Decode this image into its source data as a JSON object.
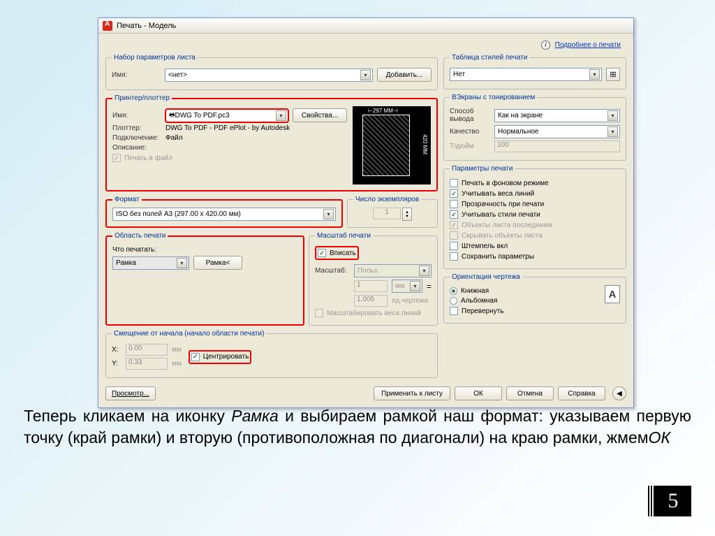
{
  "window": {
    "title": "Печать - Модель"
  },
  "info_link": "Подробнее о печати",
  "page_setup": {
    "legend": "Набор параметров листа",
    "name_label": "Имя:",
    "name_value": "<нет>",
    "add_btn": "Добавить..."
  },
  "printer": {
    "legend": "Принтер/плоттер",
    "name_label": "Имя:",
    "name_value": "DWG To PDF.pc3",
    "props_btn": "Свойства...",
    "plotter_label": "Плоттер:",
    "plotter_value": "DWG To PDF - PDF ePlot - by Autodesk",
    "conn_label": "Подключение:",
    "conn_value": "Файл",
    "desc_label": "Описание:",
    "print_to_file": "Печать в файл",
    "preview_w": "297 MM",
    "preview_h": "420 MM"
  },
  "paper": {
    "legend": "Формат",
    "value": "ISO без полей A3 (297.00 x 420.00 мм)"
  },
  "copies": {
    "legend": "Число экземпляров",
    "value": "1"
  },
  "area": {
    "legend": "Область печати",
    "what_label": "Что печатать:",
    "what_value": "Рамка",
    "window_btn": "Рамка<"
  },
  "scale": {
    "legend": "Масштаб печати",
    "fit": "Вписать",
    "scale_label": "Масштаб:",
    "scale_value": "Польз.",
    "units_value": "1",
    "units_unit": "мм",
    "drawing_value": "1.005",
    "drawing_unit": "ед.чертежа",
    "scale_lw": "Масштабировать веса линий"
  },
  "offset": {
    "legend": "Смещение от начала (начало области печати)",
    "x_label": "X:",
    "x_value": "0.00",
    "y_label": "Y:",
    "y_value": "0.33",
    "unit": "мм",
    "center": "Центрировать"
  },
  "styles": {
    "legend": "Таблица стилей печати",
    "value": "Нет"
  },
  "shaded": {
    "legend": "ВЭкраны с тонированием",
    "mode_label": "Способ вывода",
    "mode_value": "Как на экране",
    "quality_label": "Качество",
    "quality_value": "Нормальное",
    "dpi_label": "Т/дюйм",
    "dpi_value": "100"
  },
  "options": {
    "legend": "Параметры печати",
    "bg": "Печать в фоновом режиме",
    "lw": "Учитывать веса линий",
    "trans": "Прозрачность при печати",
    "plotstyles": "Учитывать стили печати",
    "paperspace_last": "Объекты листа последними",
    "hide": "Скрывать объекты листа",
    "stamp": "Штемпель вкл",
    "save": "Сохранить параметры"
  },
  "orientation": {
    "legend": "Ориентация чертежа",
    "portrait": "Книжная",
    "landscape": "Альбомная",
    "upside": "Перевернуть"
  },
  "footer": {
    "preview": "Просмотр...",
    "apply": "Применить к листу",
    "ok": "ОК",
    "cancel": "Отмена",
    "help": "Справка"
  },
  "caption_parts": {
    "p1": "Теперь кликаем на иконку ",
    "ramka": "Рамка",
    "p2": " и выбираем рамкой наш формат: указываем первую точку (край рамки) и вторую (противоположная по диагонали) на краю рамки, жмем",
    "ok": "ОК"
  },
  "page_number": "5"
}
